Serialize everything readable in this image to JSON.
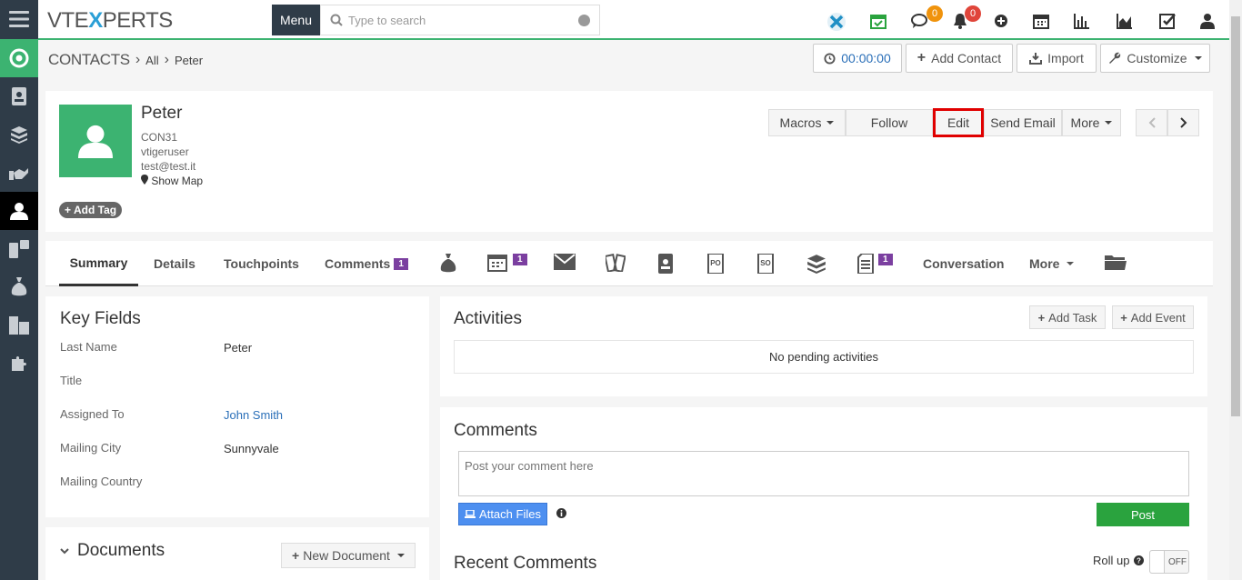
{
  "app": {
    "logo_left": "VTE",
    "logo_x": "X",
    "logo_right": "PERTS",
    "menu_label": "Menu"
  },
  "search": {
    "placeholder": "Type to search"
  },
  "header_badges": {
    "comments_count": "0",
    "notifications_count": "0"
  },
  "colors": {
    "brand_green": "#3cb371",
    "sidebar": "#2f3c48",
    "badge_orange": "#f0930c",
    "badge_red": "#e0453a",
    "tab_badge_purple": "#7b3fa0",
    "post_green": "#2aa33e",
    "attach_blue": "#4d8ff0",
    "edit_highlight": "#e00000"
  },
  "breadcrumb": {
    "module": "CONTACTS",
    "list": "All",
    "record": "Peter"
  },
  "header_buttons": {
    "timer": "00:00:00",
    "add_contact": "Add Contact",
    "import": "Import",
    "customize": "Customize"
  },
  "record": {
    "name": "Peter",
    "id": "CON31",
    "owner": "vtigeruser",
    "email": "test@test.it",
    "show_map": "Show Map",
    "add_tag": "Add Tag"
  },
  "actions": {
    "macros": "Macros",
    "follow": "Follow",
    "edit": "Edit",
    "send_email": "Send Email",
    "more": "More"
  },
  "tabs": {
    "summary": "Summary",
    "details": "Details",
    "touchpoints": "Touchpoints",
    "comments": "Comments",
    "comments_badge": "1",
    "calendar_badge": "1",
    "docs_badge": "1",
    "conversation": "Conversation",
    "more": "More"
  },
  "key_fields": {
    "title": "Key Fields",
    "rows": [
      {
        "label": "Last Name",
        "value": "Peter"
      },
      {
        "label": "Title",
        "value": ""
      },
      {
        "label": "Assigned To",
        "value": "John Smith"
      },
      {
        "label": "Mailing City",
        "value": "Sunnyvale"
      },
      {
        "label": "Mailing Country",
        "value": ""
      }
    ]
  },
  "documents": {
    "title": "Documents",
    "new_document": "New Document"
  },
  "activities": {
    "title": "Activities",
    "add_task": "Add Task",
    "add_event": "Add Event",
    "empty": "No pending activities"
  },
  "comments": {
    "title": "Comments",
    "placeholder": "Post your comment here",
    "attach_files": "Attach Files",
    "post": "Post"
  },
  "recent_comments": {
    "title": "Recent Comments",
    "roll_up": "Roll up",
    "toggle_state": "OFF"
  }
}
